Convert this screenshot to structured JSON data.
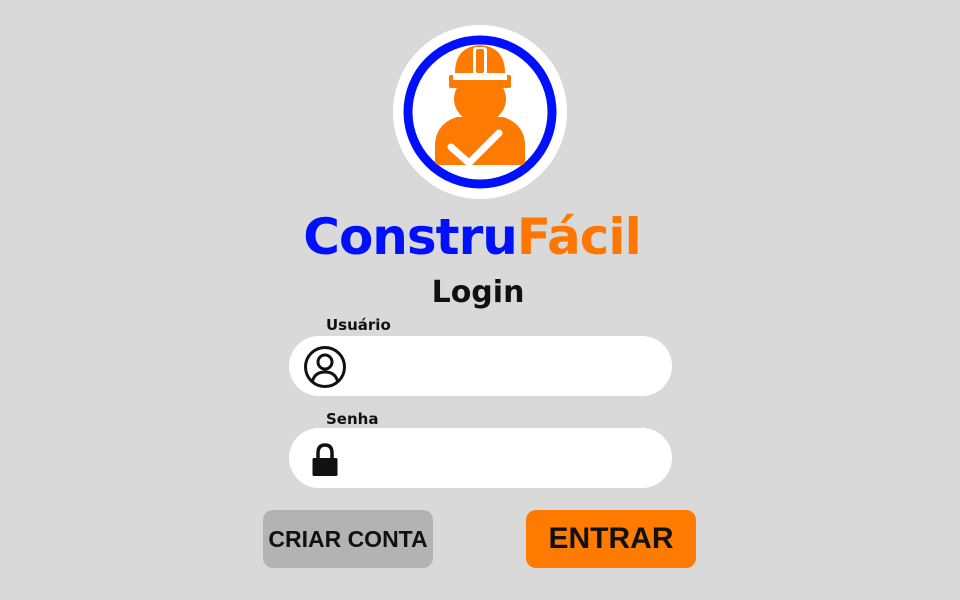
{
  "brand": {
    "part1": "Constru",
    "part2": "Fácil",
    "color_primary": "#0010ff",
    "color_accent": "#ff7700",
    "logo_icon": "construction-worker-icon"
  },
  "title": "Login",
  "fields": {
    "username": {
      "label": "Usuário",
      "value": "",
      "placeholder": "",
      "icon": "user-circle-icon"
    },
    "password": {
      "label": "Senha",
      "value": "",
      "placeholder": "",
      "icon": "lock-icon"
    }
  },
  "buttons": {
    "create_account": "CRIAR CONTA",
    "enter": "ENTRAR"
  },
  "colors": {
    "background": "#d9d9d9",
    "enter_button": "#ff7a00",
    "create_button": "#b3b3b3"
  }
}
